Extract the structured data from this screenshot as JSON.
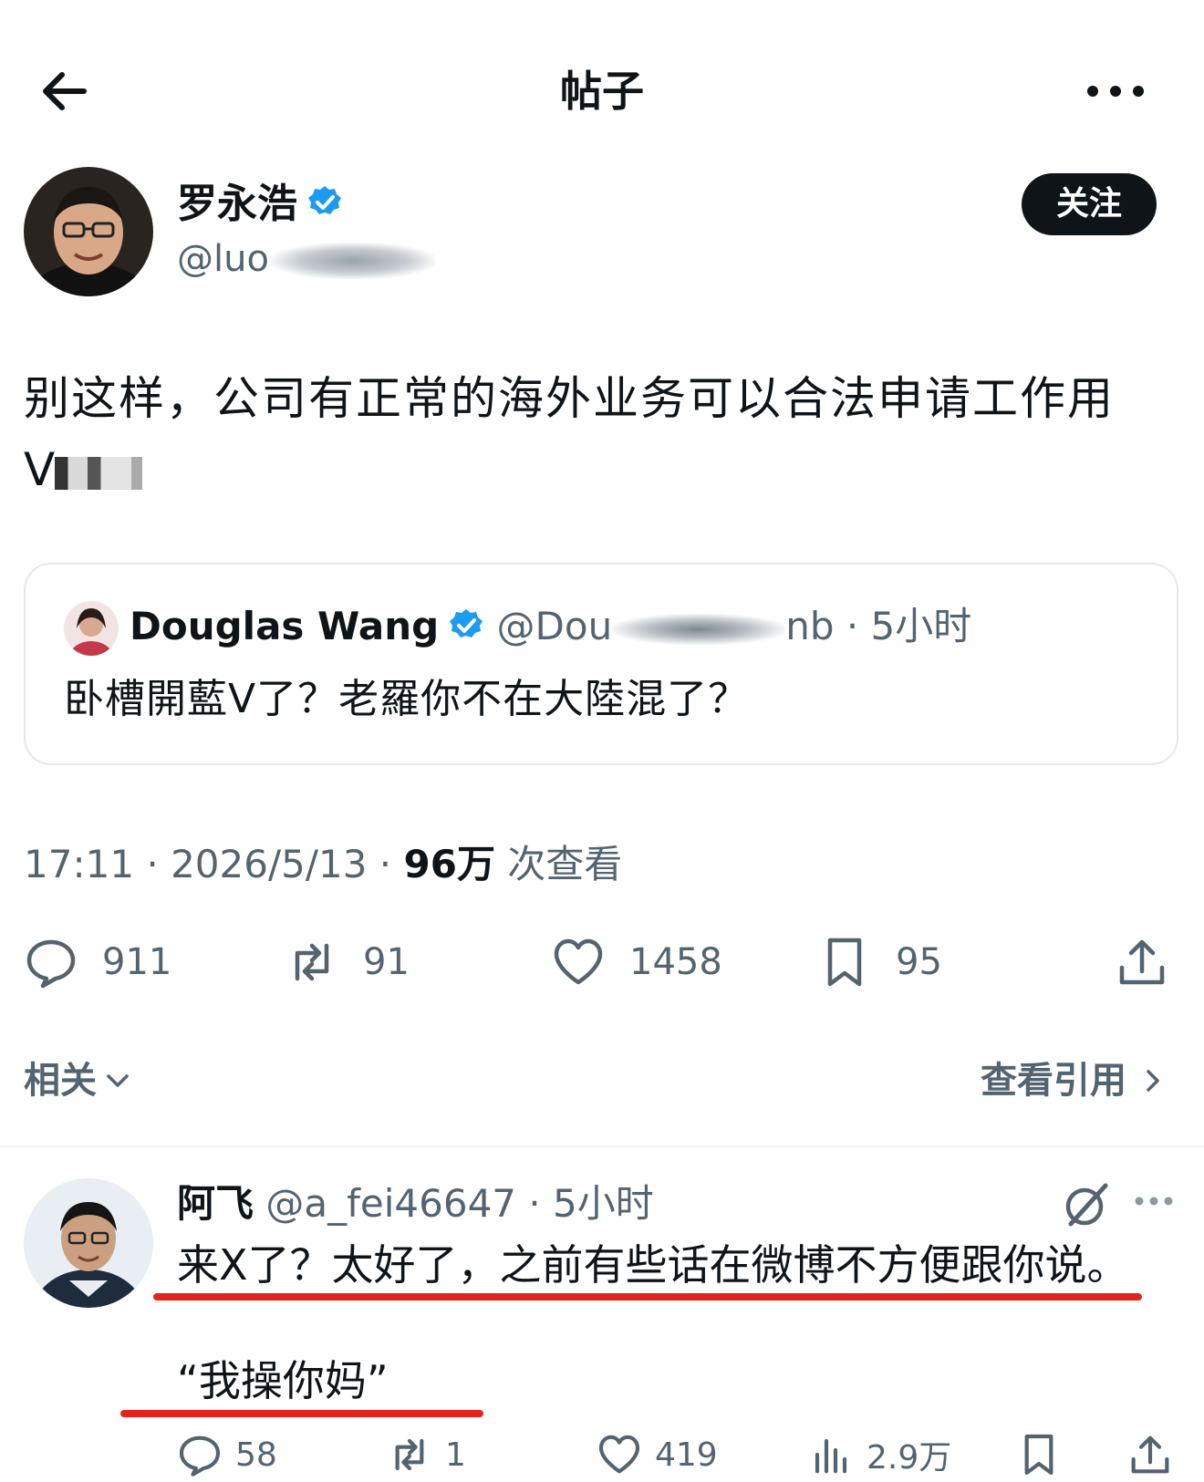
{
  "header": {
    "title": "帖子"
  },
  "post": {
    "author": {
      "name": "罗永浩",
      "handle": "@luo"
    },
    "follow_label": "关注",
    "text_line1": "别这样，公司有正常的海外业务可以合法申请工作用",
    "text_line2": "V",
    "quoted": {
      "name": "Douglas Wang",
      "handle_start": "@Dou",
      "handle_end": "nb · 5小时",
      "text": "卧槽開藍V了？老羅你不在大陸混了？"
    },
    "time": "17:11 · 2026/5/13 · ",
    "views": "96万",
    "views_label": " 次查看",
    "stats": {
      "replies": "911",
      "reposts": "91",
      "likes": "1458",
      "bookmarks": "95"
    }
  },
  "related": {
    "label": "相关",
    "view_quotes_label": "查看引用"
  },
  "reply": {
    "name": "阿飞",
    "handle_time": " @a_fei46647 · 5小时",
    "text": "来X了？太好了，之前有些话在微博不方便跟你说。",
    "quote_text": "“我操你妈”",
    "stats": {
      "replies": "58",
      "reposts": "1",
      "likes": "419",
      "views": "2.9万"
    }
  },
  "colors": {
    "accent": "#1d9bf0",
    "text": "#0f1419",
    "muted": "#536471",
    "highlight": "#e3241b"
  }
}
